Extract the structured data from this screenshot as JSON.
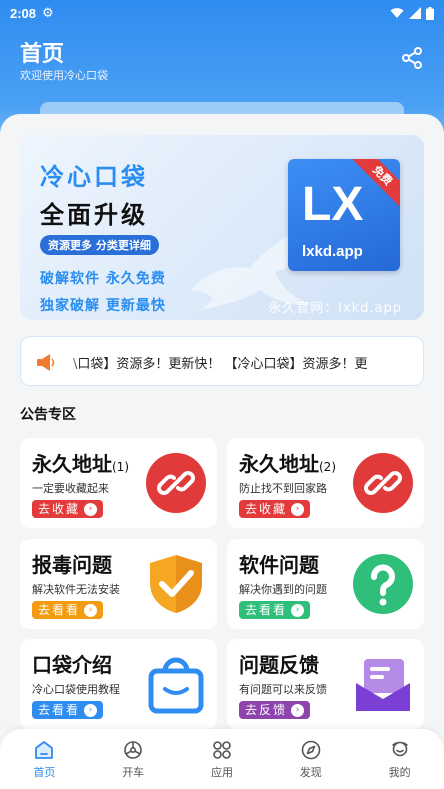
{
  "status": {
    "time": "2:08"
  },
  "header": {
    "title": "首页",
    "subtitle": "欢迎使用冷心口袋"
  },
  "banner": {
    "title": "冷心口袋",
    "line2": "全面升级",
    "pill": "资源更多 分类更详细",
    "line3": "破解软件 永久免费",
    "line4": "独家破解 更新最快",
    "site": "永久官网：lxkd.app",
    "logo_text": "LX",
    "logo_url": "lxkd.app",
    "logo_badge": "免费"
  },
  "notice": {
    "text": "\\口袋】资源多！更新快！  【冷心口袋】资源多！更"
  },
  "section_title": "公告专区",
  "cards": [
    {
      "title": "永久地址",
      "suffix": "(1)",
      "sub": "一定要收藏起来",
      "btn": "去收藏",
      "btn_color": "#e33b3b",
      "icon": "link-icon"
    },
    {
      "title": "永久地址",
      "suffix": "(2)",
      "sub": "防止找不到回家路",
      "btn": "去收藏",
      "btn_color": "#e33b3b",
      "icon": "link-icon"
    },
    {
      "title": "报毒问题",
      "suffix": "",
      "sub": "解决软件无法安装",
      "btn": "去看看",
      "btn_color": "#f39c12",
      "icon": "shield-check-icon"
    },
    {
      "title": "软件问题",
      "suffix": "",
      "sub": "解决你遇到的问题",
      "btn": "去看看",
      "btn_color": "#2fbf7a",
      "icon": "question-icon"
    },
    {
      "title": "口袋介绍",
      "suffix": "",
      "sub": "冷心口袋使用教程",
      "btn": "去看看",
      "btn_color": "#2f8cf0",
      "icon": "bag-icon"
    },
    {
      "title": "问题反馈",
      "suffix": "",
      "sub": "有问题可以来反馈",
      "btn": "去反馈",
      "btn_color": "#8e44ad",
      "icon": "mail-icon"
    }
  ],
  "nav": [
    {
      "label": "首页",
      "icon": "home-icon",
      "active": true
    },
    {
      "label": "开车",
      "icon": "car-wheel-icon"
    },
    {
      "label": "应用",
      "icon": "apps-icon"
    },
    {
      "label": "发现",
      "icon": "compass-icon"
    },
    {
      "label": "我的",
      "icon": "user-icon"
    }
  ],
  "colors": {
    "accent": "#2f8cf0"
  }
}
